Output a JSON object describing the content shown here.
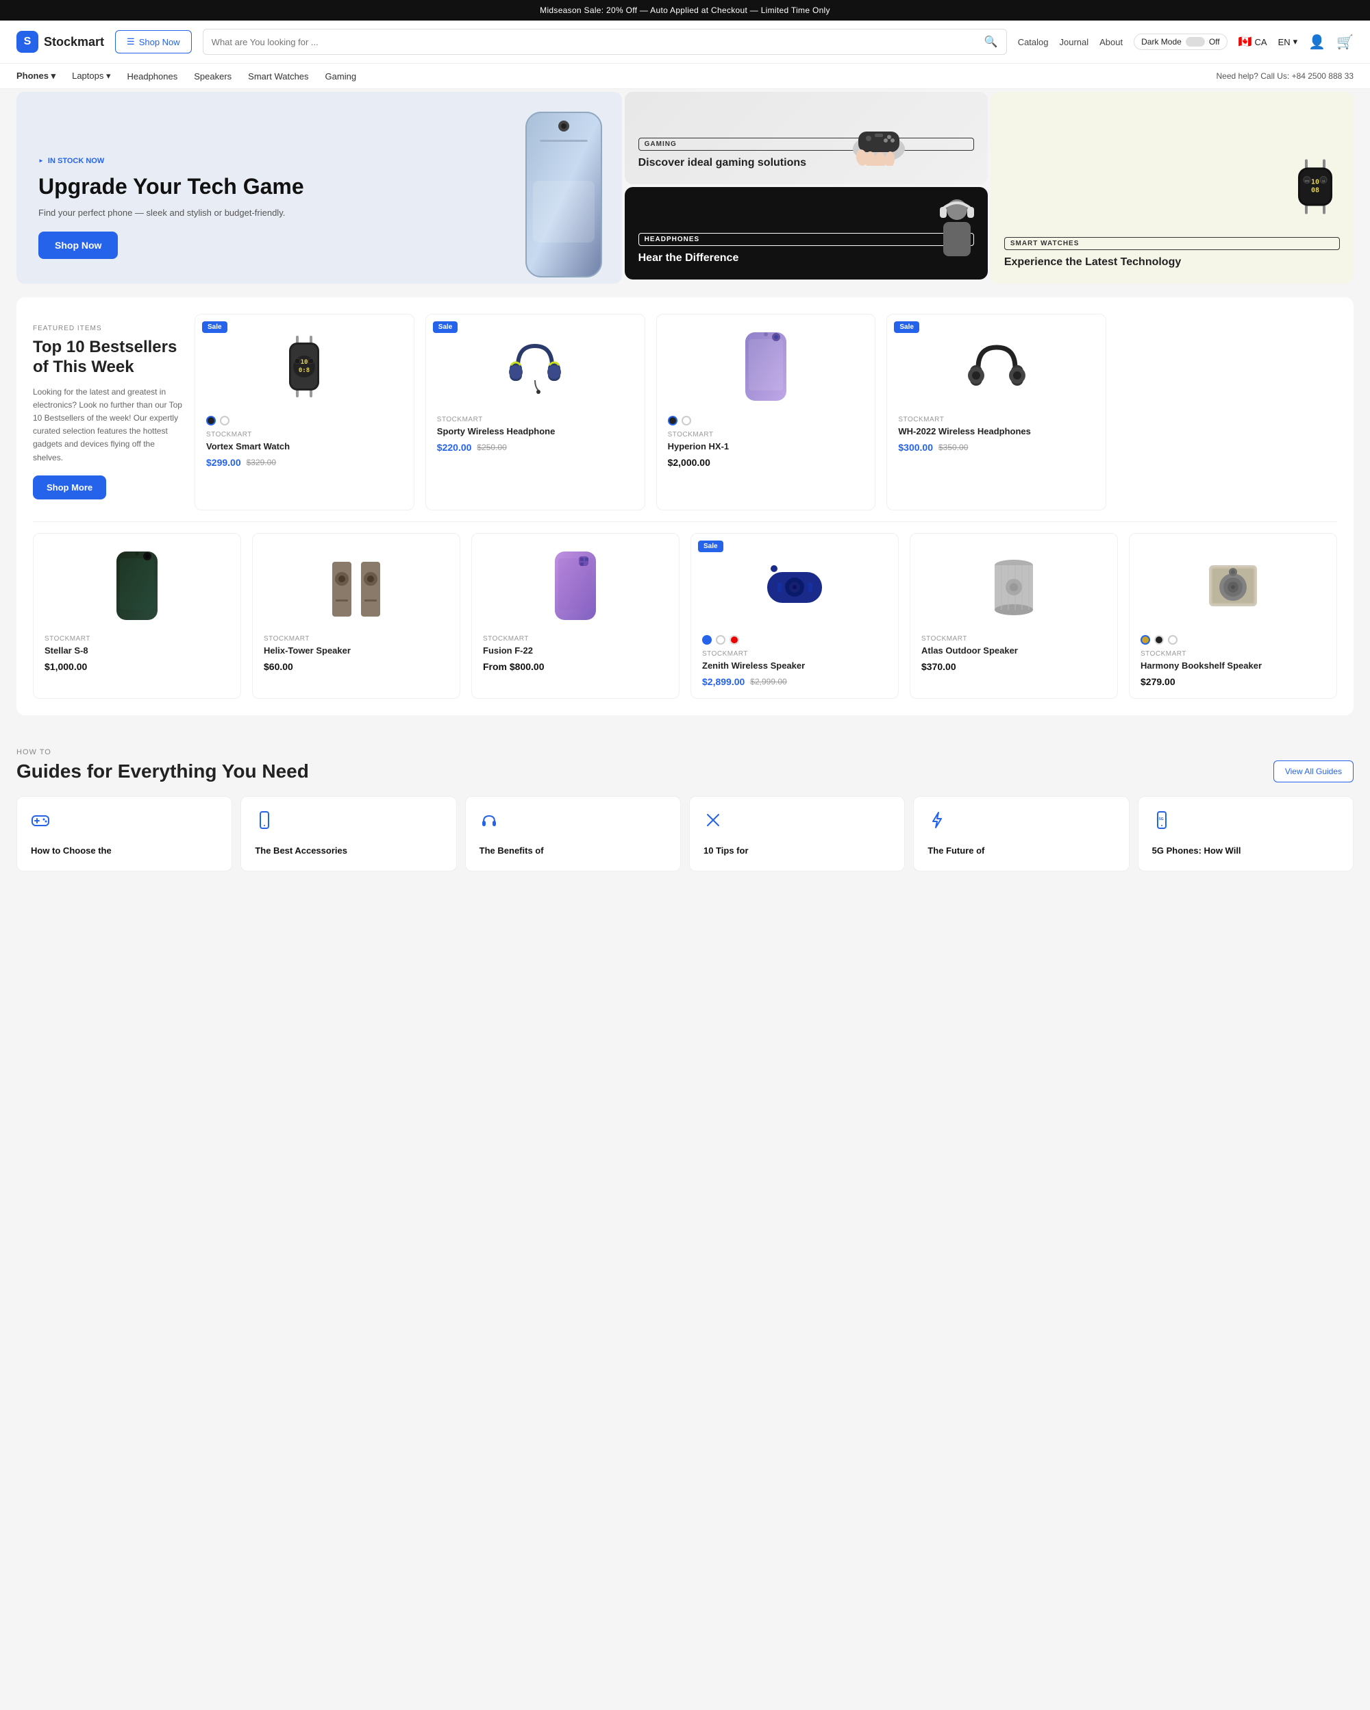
{
  "banner": {
    "text": "Midseason Sale: 20% Off — Auto Applied at Checkout — Limited Time Only"
  },
  "header": {
    "logo_text": "Stockmart",
    "shop_now_label": "Shop Now",
    "search_placeholder": "What are You looking for ...",
    "nav_items": [
      "Catalog",
      "Journal",
      "About"
    ],
    "dark_mode_label": "Dark Mode",
    "dark_mode_off": "Off",
    "region_flag": "🇨🇦",
    "region_code": "CA",
    "lang": "EN"
  },
  "category_nav": {
    "items": [
      "Phones",
      "Laptops",
      "Headphones",
      "Speakers",
      "Smart Watches",
      "Gaming"
    ],
    "help_text": "Need help? Call Us: +84 2500 888 33"
  },
  "hero": {
    "main": {
      "badge": "IN STOCK NOW",
      "title": "Upgrade Your Tech Game",
      "description": "Find your perfect phone — sleek and stylish or budget-friendly.",
      "btn_label": "Shop Now"
    },
    "gaming": {
      "badge": "GAMING",
      "title": "Discover ideal gaming solutions"
    },
    "headphones": {
      "badge": "HEADPHONES",
      "title": "Hear the Difference"
    },
    "smartwatch": {
      "badge": "SMART WATCHES",
      "title": "Experience the Latest Technology"
    }
  },
  "products": {
    "intro": {
      "label": "FEATURED ITEMS",
      "title": "Top 10 Bestsellers of This Week",
      "description": "Looking for the latest and greatest in electronics? Look no further than our Top 10 Bestsellers of the week! Our expertly curated selection features the hottest gadgets and devices flying off the shelves.",
      "btn_label": "Shop More"
    },
    "row1": [
      {
        "brand": "STOCKMART",
        "name": "Vortex Smart Watch",
        "price": "$299.00",
        "original_price": "$329.00",
        "sale": true,
        "type": "smartwatch",
        "colors": [
          "dark",
          "white"
        ]
      },
      {
        "brand": "STOCKMART",
        "name": "Sporty Wireless Headphone",
        "price": "$220.00",
        "original_price": "$250.00",
        "sale": true,
        "type": "headphone-sporty",
        "colors": []
      },
      {
        "brand": "STOCKMART",
        "name": "Hyperion HX-1",
        "price": "$2,000.00",
        "original_price": "",
        "sale": false,
        "type": "phone",
        "colors": [
          "dark",
          "white"
        ]
      },
      {
        "brand": "STOCKMART",
        "name": "WH-2022 Wireless Headphones",
        "price": "$300.00",
        "original_price": "$350.00",
        "sale": true,
        "type": "headphone-wh",
        "colors": []
      }
    ],
    "row2": [
      {
        "brand": "STOCKMART",
        "name": "Stellar S-8",
        "price": "$1,000.00",
        "original_price": "",
        "sale": false,
        "type": "phone-dark",
        "colors": []
      },
      {
        "brand": "STOCKMART",
        "name": "Helix-Tower Speaker",
        "price": "$60.00",
        "original_price": "",
        "sale": false,
        "type": "speaker-tower",
        "colors": []
      },
      {
        "brand": "STOCKMART",
        "name": "Fusion F-22",
        "price": "From $800.00",
        "original_price": "",
        "sale": false,
        "type": "phone-purple",
        "colors": []
      },
      {
        "brand": "STOCKMART",
        "name": "Zenith Wireless Speaker",
        "price": "$2,899.00",
        "original_price": "$2,999.00",
        "sale": true,
        "type": "speaker-portable",
        "colors": [
          "blue",
          "white",
          "red"
        ]
      },
      {
        "brand": "STOCKMART",
        "name": "Atlas Outdoor Speaker",
        "price": "$370.00",
        "original_price": "",
        "sale": false,
        "type": "speaker-cylinder",
        "colors": []
      },
      {
        "brand": "STOCKMART",
        "name": "Harmony Bookshelf Speaker",
        "price": "$279.00",
        "original_price": "",
        "sale": false,
        "type": "speaker-bookshelf",
        "colors": [
          "gold",
          "dark",
          "white"
        ]
      }
    ]
  },
  "guides": {
    "how_to_label": "HOW TO",
    "title": "Guides for Everything You Need",
    "view_all_label": "View All Guides",
    "items": [
      {
        "icon": "🎮",
        "title": "How to Choose the"
      },
      {
        "icon": "📱",
        "title": "The Best Accessories"
      },
      {
        "icon": "🎧",
        "title": "The Benefits of"
      },
      {
        "icon": "🔧",
        "title": "10 Tips for"
      },
      {
        "icon": "⚡",
        "title": "The Future of"
      },
      {
        "icon": "📱",
        "title": "5G Phones: How Will"
      }
    ]
  }
}
